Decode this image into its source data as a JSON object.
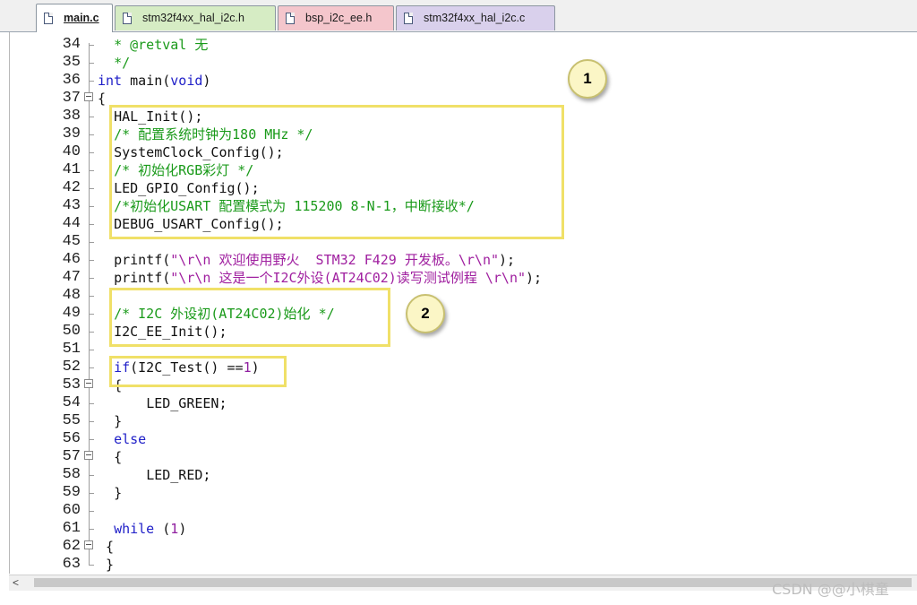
{
  "tabs": [
    {
      "label": "main.c",
      "active": true,
      "color": "#ffffff"
    },
    {
      "label": "stm32f4xx_hal_i2c.h",
      "active": false,
      "color": "#d6ecc4"
    },
    {
      "label": "bsp_i2c_ee.h",
      "active": false,
      "color": "#f4c6cc"
    },
    {
      "label": "stm32f4xx_hal_i2c.c",
      "active": false,
      "color": "#d9d0ec"
    }
  ],
  "editor": {
    "lines": [
      {
        "num": "34",
        "indent": "  ",
        "segments": [
          {
            "t": "* @retval 无",
            "c": "comment"
          }
        ]
      },
      {
        "num": "35",
        "indent": "  ",
        "segments": [
          {
            "t": "*/",
            "c": "comment"
          }
        ]
      },
      {
        "num": "36",
        "indent": "",
        "segments": [
          {
            "t": "int",
            "c": "kw"
          },
          {
            "t": " main(",
            "c": "plain"
          },
          {
            "t": "void",
            "c": "kw"
          },
          {
            "t": ")",
            "c": "plain"
          }
        ]
      },
      {
        "num": "37",
        "indent": "",
        "segments": [
          {
            "t": "{",
            "c": "plain"
          }
        ]
      },
      {
        "num": "38",
        "indent": "  ",
        "segments": [
          {
            "t": "HAL_Init();",
            "c": "plain"
          }
        ]
      },
      {
        "num": "39",
        "indent": "  ",
        "segments": [
          {
            "t": "/* 配置系统时钟为180 MHz */",
            "c": "comment"
          }
        ]
      },
      {
        "num": "40",
        "indent": "  ",
        "segments": [
          {
            "t": "SystemClock_Config();",
            "c": "plain"
          }
        ]
      },
      {
        "num": "41",
        "indent": "  ",
        "segments": [
          {
            "t": "/* 初始化RGB彩灯 */",
            "c": "comment"
          }
        ]
      },
      {
        "num": "42",
        "indent": "  ",
        "segments": [
          {
            "t": "LED_GPIO_Config();",
            "c": "plain"
          }
        ]
      },
      {
        "num": "43",
        "indent": "  ",
        "segments": [
          {
            "t": "/*初始化USART 配置模式为 115200 8-N-1，中断接收*/",
            "c": "comment"
          }
        ]
      },
      {
        "num": "44",
        "indent": "  ",
        "segments": [
          {
            "t": "DEBUG_USART_Config();",
            "c": "plain"
          }
        ]
      },
      {
        "num": "45",
        "indent": "",
        "segments": []
      },
      {
        "num": "46",
        "indent": "  ",
        "segments": [
          {
            "t": "printf(",
            "c": "plain"
          },
          {
            "t": "\"\\r\\n 欢迎使用野火  STM32 F429 开发板。\\r\\n\"",
            "c": "str"
          },
          {
            "t": ");",
            "c": "plain"
          }
        ]
      },
      {
        "num": "47",
        "indent": "  ",
        "segments": [
          {
            "t": "printf(",
            "c": "plain"
          },
          {
            "t": "\"\\r\\n 这是一个I2C外设(AT24C02)读写测试例程 \\r\\n\"",
            "c": "str"
          },
          {
            "t": ");",
            "c": "plain"
          }
        ]
      },
      {
        "num": "48",
        "indent": "",
        "segments": []
      },
      {
        "num": "49",
        "indent": "  ",
        "segments": [
          {
            "t": "/* I2C 外设初(AT24C02)始化 */",
            "c": "comment"
          }
        ]
      },
      {
        "num": "50",
        "indent": "  ",
        "segments": [
          {
            "t": "I2C_EE_Init();",
            "c": "plain"
          }
        ]
      },
      {
        "num": "51",
        "indent": "",
        "segments": []
      },
      {
        "num": "52",
        "indent": "  ",
        "segments": [
          {
            "t": "if",
            "c": "kw"
          },
          {
            "t": "(I2C_Test() ==",
            "c": "plain"
          },
          {
            "t": "1",
            "c": "num"
          },
          {
            "t": ")",
            "c": "plain"
          }
        ]
      },
      {
        "num": "53",
        "indent": "  ",
        "segments": [
          {
            "t": "{",
            "c": "plain"
          }
        ]
      },
      {
        "num": "54",
        "indent": "      ",
        "segments": [
          {
            "t": "LED_GREEN;",
            "c": "plain"
          }
        ]
      },
      {
        "num": "55",
        "indent": "  ",
        "segments": [
          {
            "t": "}",
            "c": "plain"
          }
        ]
      },
      {
        "num": "56",
        "indent": "  ",
        "segments": [
          {
            "t": "else",
            "c": "kw"
          }
        ]
      },
      {
        "num": "57",
        "indent": "  ",
        "segments": [
          {
            "t": "{",
            "c": "plain"
          }
        ]
      },
      {
        "num": "58",
        "indent": "      ",
        "segments": [
          {
            "t": "LED_RED;",
            "c": "plain"
          }
        ]
      },
      {
        "num": "59",
        "indent": "  ",
        "segments": [
          {
            "t": "}",
            "c": "plain"
          }
        ]
      },
      {
        "num": "60",
        "indent": "",
        "segments": []
      },
      {
        "num": "61",
        "indent": "  ",
        "segments": [
          {
            "t": "while",
            "c": "kw"
          },
          {
            "t": " (",
            "c": "plain"
          },
          {
            "t": "1",
            "c": "num"
          },
          {
            "t": ")",
            "c": "plain"
          }
        ]
      },
      {
        "num": "62",
        "indent": " ",
        "segments": [
          {
            "t": "{",
            "c": "plain"
          }
        ]
      },
      {
        "num": "63",
        "indent": " ",
        "segments": [
          {
            "t": "}",
            "c": "plain"
          }
        ]
      }
    ],
    "fold_markers": [
      "37",
      "53",
      "57",
      "62"
    ]
  },
  "callouts": [
    "1",
    "2"
  ],
  "colors": {
    "comment": "#1a9a1a",
    "keyword": "#2020c8",
    "string": "#a020a0",
    "highlight_box": "#f0e068"
  },
  "scrollbar": {
    "left_arrow": "<"
  },
  "watermark": "CSDN @@小棋童"
}
